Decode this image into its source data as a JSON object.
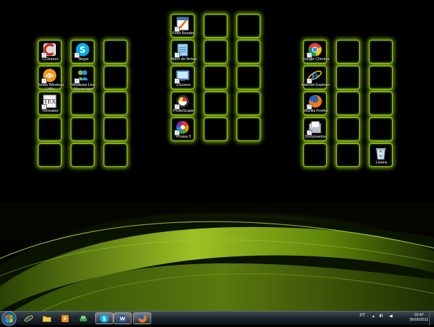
{
  "desktop": {
    "groups": [
      {
        "icons": [
          {
            "label": "CCleaner",
            "icon": "ccleaner-icon"
          },
          {
            "label": "Skype",
            "icon": "skype-icon"
          },
          null,
          {
            "label": "Tenda Wireless Utility",
            "icon": "tenda-icon"
          },
          {
            "label": "Windows Live Messenger",
            "icon": "messenger-icon"
          },
          null,
          {
            "label": "Texmaker",
            "icon": "texmaker-icon"
          },
          null,
          null,
          null,
          null,
          null,
          null,
          null,
          null
        ]
      },
      {
        "icons": [
          {
            "label": "Foxit Reader",
            "icon": "foxit-icon"
          },
          null,
          null,
          {
            "label": "Bloco de Notas",
            "icon": "notepad-icon"
          },
          null,
          null,
          {
            "label": "ZScreen",
            "icon": "zscreen-icon"
          },
          null,
          null,
          {
            "label": "PhotoScape",
            "icon": "photoscape-icon"
          },
          null,
          null,
          {
            "label": "Picasa 3",
            "icon": "picasa-icon"
          },
          null,
          null
        ]
      },
      {
        "icons": [
          {
            "label": "Google Chrome",
            "icon": "chrome-icon"
          },
          null,
          null,
          {
            "label": "Internet Explorer",
            "icon": "ie-icon"
          },
          null,
          null,
          {
            "label": "Mozilla Firefox",
            "icon": "firefox-icon"
          },
          null,
          null,
          {
            "label": "Documentos",
            "icon": "documents-icon"
          },
          null,
          null,
          null,
          null,
          {
            "label": "Lixeira",
            "icon": "recycle-bin-icon"
          }
        ]
      }
    ]
  },
  "taskbar": {
    "pinned": [
      {
        "name": "internet-explorer",
        "icon": "ie-icon",
        "active": false
      },
      {
        "name": "windows-explorer",
        "icon": "folder-icon",
        "active": false
      },
      {
        "name": "media-player",
        "icon": "media-player-icon",
        "active": false
      },
      {
        "name": "network-app",
        "icon": "network-icon",
        "active": false
      },
      {
        "name": "skype",
        "icon": "skype-icon",
        "active": true
      },
      {
        "name": "word",
        "icon": "word-icon",
        "active": true
      },
      {
        "name": "firefox",
        "icon": "firefox-icon",
        "active": true
      }
    ],
    "language": "PT",
    "time": "16:47",
    "date": "26/05/2011"
  },
  "colors": {
    "glow": "#9bd11a",
    "taskbar": "#1c252d"
  }
}
